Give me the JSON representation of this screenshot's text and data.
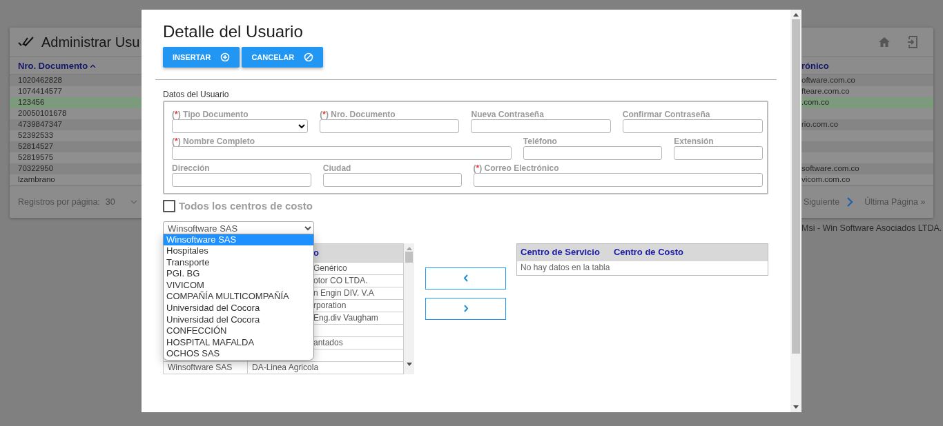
{
  "background_page": {
    "title": "Administrar Usu",
    "table": {
      "columns": [
        "Nro. Documento",
        "rónico"
      ],
      "rows": [
        {
          "column_1": "1020462828",
          "column_2": "oftware.com.co",
          "selected": false
        },
        {
          "column_1": "1074414577",
          "column_2": "fteare.com.co",
          "selected": false
        },
        {
          "column_1": "123456",
          "column_2": ".com.co",
          "selected": true
        },
        {
          "column_1": "20050101678",
          "selected": false
        },
        {
          "column_1": "4739847347",
          "column_2": "rio.com.co",
          "selected": false
        },
        {
          "column_1": "52392533",
          "selected": false
        },
        {
          "column_1": "52814527",
          "selected": false
        },
        {
          "column_1": "52819575",
          "selected": false
        },
        {
          "column_1": "70322950",
          "column_2": "software.com.co",
          "selected": false
        },
        {
          "column_1": "lzambrano",
          "column_2": "vicom.com.co",
          "selected": false
        }
      ]
    },
    "footer": {
      "rows_per_page_label": "Registros por página:",
      "rows_per_page_value": "30",
      "next": "Siguiente",
      "last": "Última Página »"
    },
    "copyright": "Msi - Win Software Asociados LTDA."
  },
  "modal": {
    "title": "Detalle del Usuario",
    "buttons": [
      {
        "label": "INSERTAR",
        "kind": "insert"
      },
      {
        "label": "CANCELAR",
        "kind": "cancel"
      }
    ],
    "section_label": "Datos del Usuario",
    "field_rows": [
      [
        {
          "label": "Tipo Documento",
          "required_mark": "(*)",
          "kind": "select"
        },
        {
          "label": "Nro. Documento",
          "required_mark": "(*)",
          "kind": "text"
        },
        {
          "label": "Nueva Contraseña",
          "kind": "text"
        },
        {
          "label": "Confirmar Contraseña",
          "kind": "text"
        }
      ],
      [
        {
          "label": "Nombre Completo",
          "required_mark": "(*)",
          "kind": "text"
        },
        {
          "label": "Teléfono",
          "kind": "text"
        },
        {
          "label": "Extensión",
          "kind": "text"
        }
      ],
      [
        {
          "label": "Dirección",
          "kind": "text"
        },
        {
          "label": "Ciudad",
          "kind": "text"
        },
        {
          "label": "Correo Electrónico",
          "required_mark": "(*)",
          "kind": "text"
        }
      ]
    ],
    "all_cost_centers": {
      "label": "Todos los centros de costo",
      "checked": false
    },
    "company_select": {
      "value": "Winsoftware SAS",
      "expanded": true,
      "options": [
        {
          "label": "Winsoftware SAS",
          "selected": true
        },
        {
          "label": "Hospitales",
          "selected": false
        },
        {
          "label": "Transporte",
          "selected": false
        },
        {
          "label": "PGI. BG",
          "selected": false
        },
        {
          "label": "VIVICOM",
          "selected": false
        },
        {
          "label": "COMPAÑÍA MULTICOMPAÑÍA",
          "selected": false
        },
        {
          "label": "Universidad del Cocora",
          "selected": false
        },
        {
          "label": "Universidad del Cocora",
          "selected": false
        },
        {
          "label": "CONFECCIÓN",
          "selected": false
        },
        {
          "label": "HOSPITAL MAFALDA",
          "selected": false
        },
        {
          "label": "OCHOS SAS",
          "selected": false
        }
      ]
    },
    "available_table": {
      "column_2": "o",
      "rows": [
        {
          "column_2": "Genérico"
        },
        {
          "column_2": "otor CO LTDA."
        },
        {
          "column_2": "n Engin DIV. V.A"
        },
        {
          "column_2": "rporation"
        },
        {
          "column_2": "Eng.div Vaugham"
        },
        {},
        {
          "column_2": "antados"
        },
        {},
        {
          "column_1": "Winsoftware SAS",
          "column_2": "DA-Linea Agricola"
        }
      ]
    },
    "transfer_buttons": [
      {
        "kind": "left"
      },
      {
        "kind": "right"
      }
    ],
    "assigned_table": {
      "columns": [
        "Centro de Servicio",
        "Centro de Costo"
      ],
      "empty_message": "No hay datos en la tabla"
    }
  }
}
